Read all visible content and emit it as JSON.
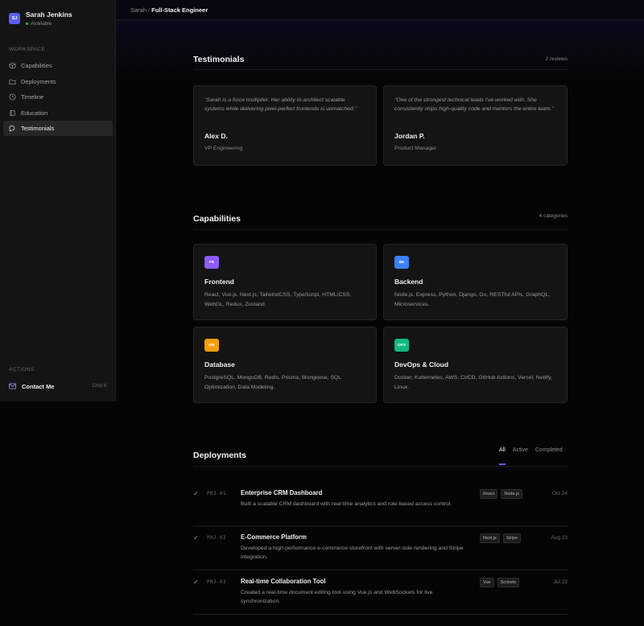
{
  "profile": {
    "initials": "SJ",
    "name": "Sarah Jenkins",
    "status": "Available"
  },
  "sidebar": {
    "workspace_label": "WORKSPACE",
    "items": [
      {
        "label": "Capabilities",
        "icon": "cube-icon",
        "active": false
      },
      {
        "label": "Deployments",
        "icon": "folder-icon",
        "active": false
      },
      {
        "label": "Timeline",
        "icon": "clock-icon",
        "active": false
      },
      {
        "label": "Education",
        "icon": "book-icon",
        "active": false
      },
      {
        "label": "Testimonials",
        "icon": "chat-bubble-icon",
        "active": true
      }
    ],
    "actions_label": "ACTIONS",
    "contact_label": "Contact Me",
    "contact_shortcut": "Cmd K"
  },
  "breadcrumb": {
    "parent": "Sarah",
    "separator": "/",
    "current": "Full-Stack Engineer"
  },
  "testimonials": {
    "title": "Testimonials",
    "meta": "2 reviews",
    "items": [
      {
        "quote": "\"Sarah is a force multiplier. Her ability to architect scalable systems while delivering pixel-perfect frontends is unmatched.\"",
        "author": "Alex D.",
        "role": "VP Engineering"
      },
      {
        "quote": "\"One of the strongest technical leads I've worked with. She consistently ships high-quality code and mentors the entire team.\"",
        "author": "Jordan P.",
        "role": "Product Manager"
      }
    ]
  },
  "capabilities": {
    "title": "Capabilities",
    "meta": "4 categories",
    "items": [
      {
        "icon_text": "FE",
        "color": "#8b5cf6",
        "title": "Frontend",
        "desc": "React, Vue.js, Next.js, TailwindCSS, TypeScript, HTML/CSS, WebGL, Redux, Zustand."
      },
      {
        "icon_text": "BE",
        "color": "#3b82f6",
        "title": "Backend",
        "desc": "Node.js, Express, Python, Django, Go, RESTful APIs, GraphQL, Microservices."
      },
      {
        "icon_text": "DB",
        "color": "#f59e0b",
        "title": "Database",
        "desc": "PostgreSQL, MongoDB, Redis, Prisma, Mongoose, SQL Optimization, Data Modeling."
      },
      {
        "icon_text": "OPS",
        "color": "#10b981",
        "title": "DevOps & Cloud",
        "desc": "Docker, Kubernetes, AWS, CI/CD, GitHub Actions, Vercel, Netlify, Linux."
      }
    ]
  },
  "deployments": {
    "title": "Deployments",
    "tabs": [
      {
        "label": "All",
        "active": true
      },
      {
        "label": "Active",
        "active": false
      },
      {
        "label": "Completed",
        "active": false
      }
    ],
    "rows": [
      {
        "code": "PRJ-01",
        "title": "Enterprise CRM Dashboard",
        "desc": "Built a scalable CRM dashboard with real-time analytics and role-based access control.",
        "tags": [
          "React",
          "Node.js"
        ],
        "date": "Oct 24"
      },
      {
        "code": "PRJ-02",
        "title": "E-Commerce Platform",
        "desc": "Developed a high-performance e-commerce storefront with server-side rendering and Stripe integration.",
        "tags": [
          "Next.js",
          "Stripe"
        ],
        "date": "Aug 23"
      },
      {
        "code": "PRJ-03",
        "title": "Real-time Collaboration Tool",
        "desc": "Created a real-time document editing tool using Vue.js and WebSockets for live synchronization.",
        "tags": [
          "Vue",
          "Sockets"
        ],
        "date": "Jul 22"
      }
    ]
  }
}
